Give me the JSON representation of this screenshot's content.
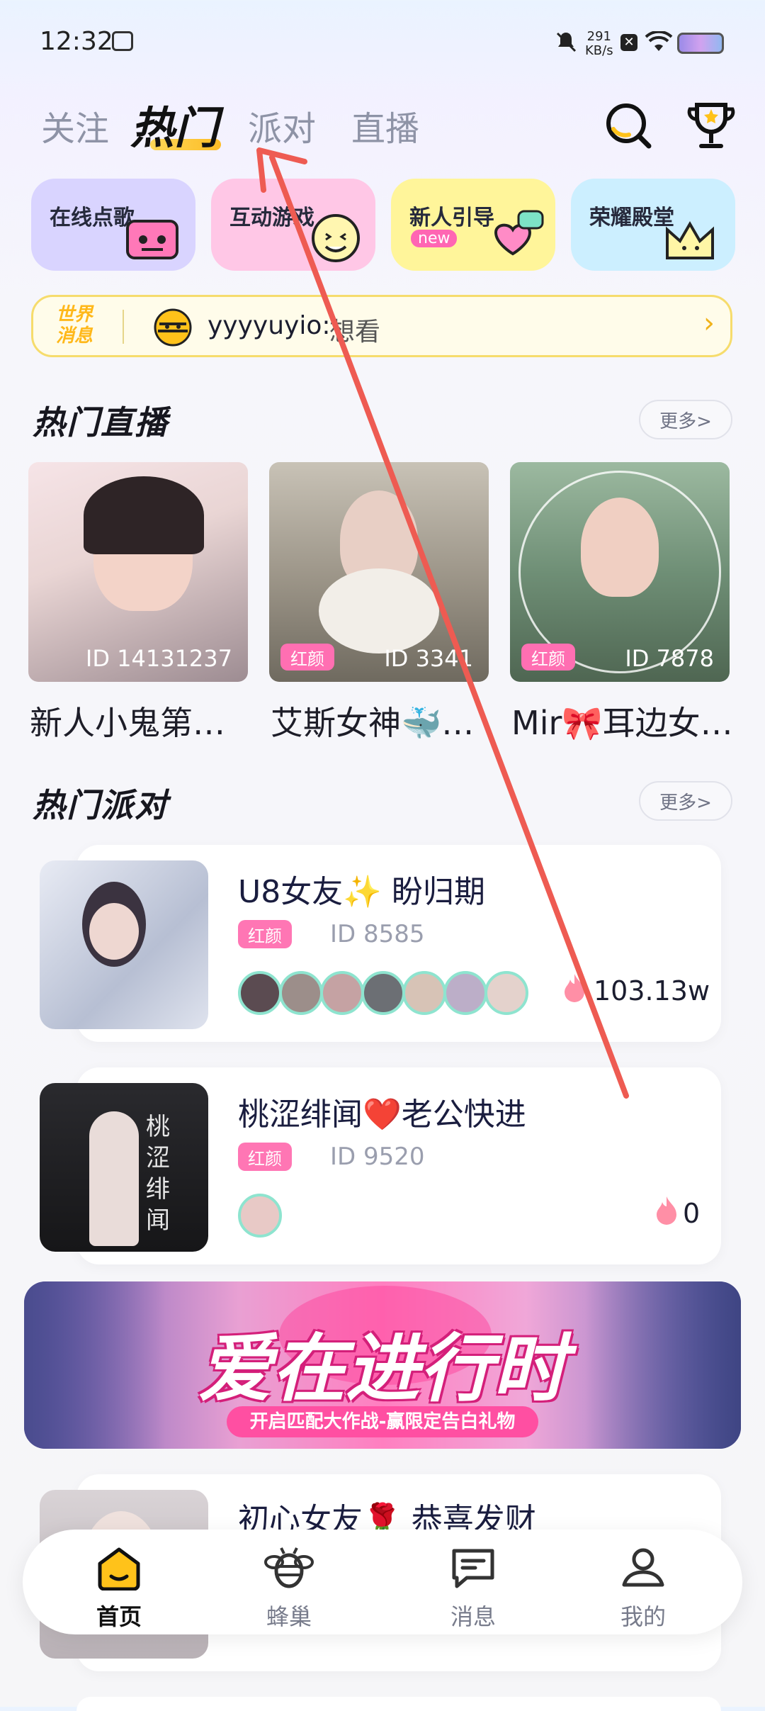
{
  "status_bar": {
    "time": "12:32",
    "net_speed_value": "291",
    "net_speed_unit": "KB/s"
  },
  "top_tabs": [
    {
      "label": "关注",
      "active": false
    },
    {
      "label": "热门",
      "active": true
    },
    {
      "label": "派对",
      "active": false
    },
    {
      "label": "直播",
      "active": false
    }
  ],
  "quick_cards": [
    {
      "label": "在线点歌",
      "color": "#d9d4ff"
    },
    {
      "label": "互动游戏",
      "color": "#ffc7e6"
    },
    {
      "label": "新人引导",
      "badge": "new",
      "color": "#fff59a"
    },
    {
      "label": "荣耀殿堂",
      "color": "#ccefff"
    }
  ],
  "world_message": {
    "tag_line1": "世界",
    "tag_line2": "消息",
    "user": "yyyyuyio:",
    "text": "想看"
  },
  "hot_live": {
    "title": "热门直播",
    "more": "更多>",
    "items": [
      {
        "id": "ID 14131237",
        "name": "新人小鬼第…",
        "badge": ""
      },
      {
        "id": "ID 3341",
        "name": "艾斯女神🐳…",
        "badge": "红颜"
      },
      {
        "id": "ID 7878",
        "name": "Mir🎀耳边女…",
        "badge": "红颜"
      }
    ]
  },
  "hot_party": {
    "title": "热门派对",
    "more": "更多>",
    "items": [
      {
        "title": "U8女友✨ 盼归期",
        "badge": "红颜",
        "id": "ID 8585",
        "heat": "103.13w",
        "avatar_count": 7
      },
      {
        "title": "桃涩绯闻❤️老公快进",
        "badge": "红颜",
        "id": "ID 9520",
        "heat": "0",
        "avatar_count": 1
      },
      {
        "title": "初心女友🌹 恭喜发财",
        "badge": "",
        "id": "",
        "heat": "",
        "avatar_count": 7
      }
    ]
  },
  "banner": {
    "headline": "爱在进行时",
    "sub": "开启匹配大作战-赢限定告白礼物"
  },
  "bottom_nav": [
    {
      "label": "首页",
      "icon": "home-icon",
      "active": true
    },
    {
      "label": "蜂巢",
      "icon": "bee-icon",
      "active": false
    },
    {
      "label": "消息",
      "icon": "message-icon",
      "active": false
    },
    {
      "label": "我的",
      "icon": "profile-icon",
      "active": false
    }
  ],
  "colors": {
    "accent": "#ffc21a",
    "badge_pink": "#ff76b4",
    "annotation_arrow": "#ee5b52"
  }
}
